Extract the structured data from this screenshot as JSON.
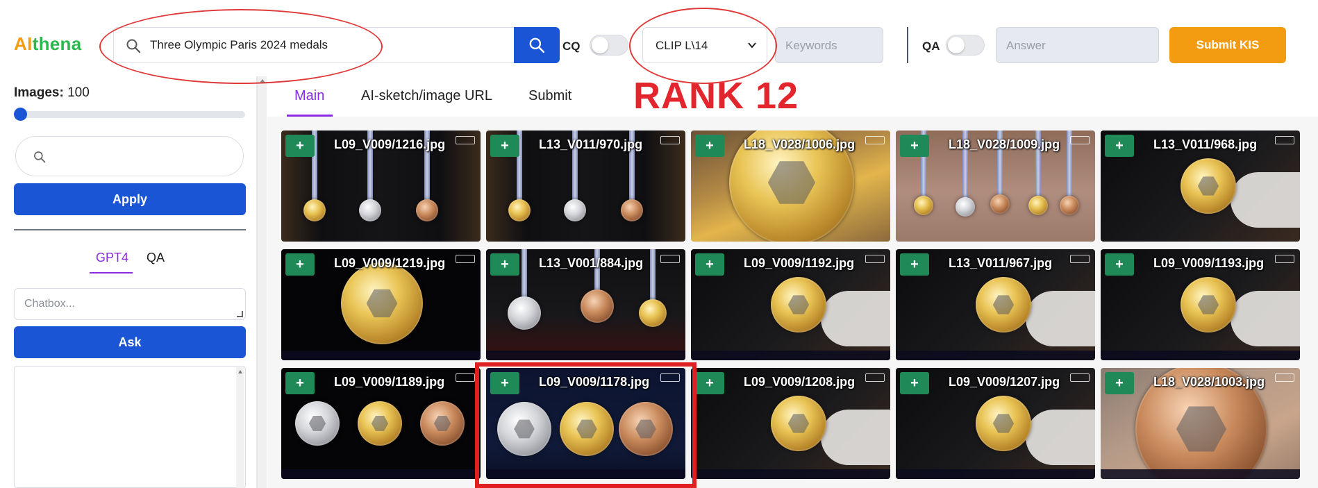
{
  "header": {
    "logo_part1": "AI",
    "logo_part2": "thena",
    "search_value": "Three Olympic Paris 2024 medals",
    "cq_label": "CQ",
    "model_select": "CLIP L\\14",
    "keywords_placeholder": "Keywords",
    "qa_label": "QA",
    "answer_placeholder": "Answer",
    "submit_kis_label": "Submit KIS"
  },
  "sidebar": {
    "images_label": "Images:",
    "images_count": "100",
    "images_slider_fraction": 0.0,
    "apply_label": "Apply",
    "tabs": [
      {
        "label": "GPT4",
        "active": true
      },
      {
        "label": "QA",
        "active": false
      }
    ],
    "chatbox_placeholder": "Chatbox...",
    "ask_label": "Ask"
  },
  "main": {
    "tabs": [
      {
        "label": "Main",
        "active": true
      },
      {
        "label": "AI-sketch/image URL",
        "active": false
      },
      {
        "label": "Submit",
        "active": false
      }
    ],
    "annotation": "RANK 12",
    "results": [
      {
        "file": "L09_V009/1216.jpg",
        "scene": "three-dark"
      },
      {
        "file": "L13_V011/970.jpg",
        "scene": "three-dark"
      },
      {
        "file": "L18_V028/1006.jpg",
        "scene": "gold-closeup"
      },
      {
        "file": "L18_V028/1009.jpg",
        "scene": "row-medals"
      },
      {
        "file": "L13_V011/968.jpg",
        "scene": "gold-hand"
      },
      {
        "file": "L09_V009/1219.jpg",
        "scene": "gold-center"
      },
      {
        "file": "L13_V001/884.jpg",
        "scene": "three-case"
      },
      {
        "file": "L09_V009/1192.jpg",
        "scene": "gold-hand"
      },
      {
        "file": "L13_V011/967.jpg",
        "scene": "gold-hand"
      },
      {
        "file": "L09_V009/1193.jpg",
        "scene": "gold-hand"
      },
      {
        "file": "L09_V009/1189.jpg",
        "scene": "three-row"
      },
      {
        "file": "L09_V009/1178.jpg",
        "scene": "three-big",
        "highlighted": true
      },
      {
        "file": "L09_V009/1208.jpg",
        "scene": "gold-hand"
      },
      {
        "file": "L09_V009/1207.jpg",
        "scene": "gold-hand"
      },
      {
        "file": "L18_V028/1003.jpg",
        "scene": "bronze-closeup"
      }
    ]
  },
  "colors": {
    "primary": "#1a55d6",
    "accent": "#f39c12",
    "tab_active": "#8a2be2",
    "annotation_red": "#e3262d",
    "add_button": "#1f8a58"
  },
  "icons": {
    "search": "search-icon",
    "chevron": "chevron-down-icon",
    "add": "plus-icon",
    "broadcaster": "vtv-logo-icon"
  }
}
